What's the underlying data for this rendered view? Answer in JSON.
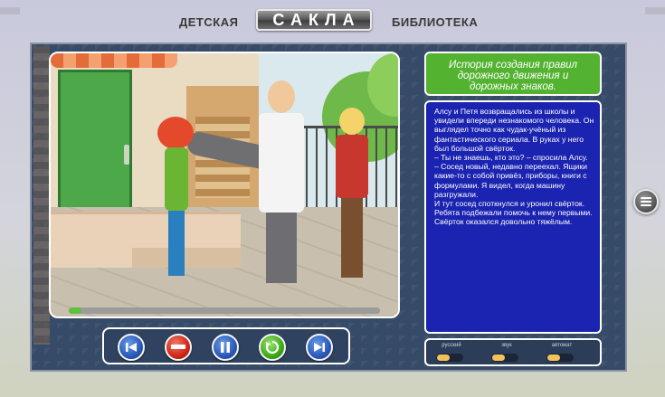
{
  "header": {
    "left_link": "ДЕТСКАЯ",
    "logo": "САКЛА",
    "right_link": "БИБЛИОТЕКА"
  },
  "story": {
    "title": "История создания правил дорожного движения и дорожных знаков.",
    "text": "Алсу и Петя возвращались из школы и увидели впереди незнакомого человека. Он выглядел точно как чудак-учёный из фантастического сериала. В руках у него был большой свёрток.\n– Ты не знаешь, кто это? – спросила Алсу.\n– Сосед новый, недавно переехал. Ящики какие-то с собой привёз, приборы, книги с формулами. Я видел, когда машину разгружали.\nИ тут сосед споткнулся и уронил свёрток. Ребята подбежали помочь к нему первыми. Свёрток оказался довольно тяжёлым."
  },
  "player": {
    "progress": 0.04,
    "buttons": [
      "previous-icon",
      "stop-icon",
      "pause-icon",
      "replay-icon",
      "next-icon"
    ]
  },
  "settings": {
    "options": [
      {
        "label": "русский"
      },
      {
        "label": "звук"
      },
      {
        "label": "автомат"
      }
    ]
  },
  "colors": {
    "title_bg": "#53b331",
    "text_bg": "#1b24b0",
    "progress_fill": "#5cc23a"
  }
}
